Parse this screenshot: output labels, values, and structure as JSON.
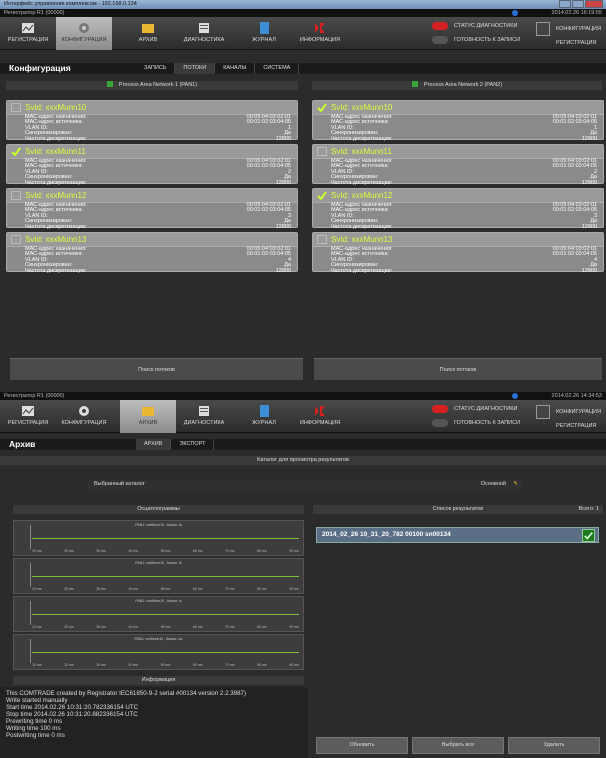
{
  "window_title": "Интерфейс управления комплексом - 192.168.0.134",
  "s1": {
    "device": "Регистратор R1 (00000)",
    "datetime": "2014.02.26 16:19:55"
  },
  "s2": {
    "device": "Регистратор R1 (00000)",
    "datetime": "2014.02.26 14:34:53"
  },
  "toolbar": {
    "items": [
      "РЕГИСТРАЦИЯ",
      "КОНФИГУРАЦИЯ",
      "АРХИВ",
      "ДИАГНОСТИКА",
      "ЖУРНАЛ",
      "ИНФОРМАЦИЯ"
    ],
    "status_diag": "СТАТУС ДИАГНОСТИКИ",
    "ready": "ГОТОВНОСТЬ К ЗАПИСИ",
    "r_conf": "КОНФИГУРАЦИЯ",
    "r_reg": "РЕГИСТРАЦИЯ",
    "status_color": "#d42020",
    "ready_color": "#555555"
  },
  "config": {
    "title": "Конфигурация",
    "tabs": [
      "ЗАПИСЬ",
      "ПОТОКИ",
      "КАНАЛЫ",
      "СИСТЕМА"
    ],
    "active_tab": "ПОТОКИ",
    "pan1": "Process Area Network 1 (PAN1)",
    "pan2": "Process Area Network 2 (PAN2)",
    "labels": {
      "dst": "МАС-адрес назначения:",
      "src": "МАС-адрес источника:",
      "vlan": "VLAN ID:",
      "sync": "Синхронизирован:",
      "rate": "Частота дискретизации:"
    },
    "left": [
      {
        "name": "SvId: xxxMunn10",
        "checked": false,
        "dst": "00:05:04:03:02:01",
        "src": "00:01:02:03:04:05",
        "vlan": "1",
        "sync": "Да",
        "rate": "12800"
      },
      {
        "name": "SvId: xxxMunn11",
        "checked": true,
        "dst": "00:05:04:03:02:01",
        "src": "00:01:02:03:04:05",
        "vlan": "2",
        "sync": "Да",
        "rate": "12800"
      },
      {
        "name": "SvId: xxxMunn12",
        "checked": false,
        "dst": "00:05:04:03:02:01",
        "src": "00:01:02:03:04:05",
        "vlan": "3",
        "sync": "Да",
        "rate": "12800"
      },
      {
        "name": "SvId: xxxMunn13",
        "checked": false,
        "dst": "00:05:04:03:02:01",
        "src": "00:01:02:03:04:05",
        "vlan": "4",
        "sync": "Да",
        "rate": "12800"
      }
    ],
    "right": [
      {
        "name": "SvId: xxxMunn10",
        "checked": true,
        "dst": "00:05:04:03:02:01",
        "src": "00:01:02:03:04:05",
        "vlan": "1",
        "sync": "Да",
        "rate": "12800"
      },
      {
        "name": "SvId: xxxMunn11",
        "checked": false,
        "dst": "00:05:04:03:02:01",
        "src": "00:01:02:03:04:05",
        "vlan": "2",
        "sync": "Да",
        "rate": "12800"
      },
      {
        "name": "SvId: xxxMunn12",
        "checked": true,
        "dst": "00:05:04:03:02:01",
        "src": "00:01:02:03:04:05",
        "vlan": "3",
        "sync": "Да",
        "rate": "12800"
      },
      {
        "name": "SvId: xxxMunn13",
        "checked": false,
        "dst": "00:05:04:03:02:01",
        "src": "00:01:02:03:04:05",
        "vlan": "4",
        "sync": "Да",
        "rate": "12800"
      }
    ],
    "search": "Поиск потоков"
  },
  "archive": {
    "title": "Архив",
    "tabs": [
      "АРХИВ",
      "ЭКСПОРТ"
    ],
    "catalog_header": "Каталог для просмотра результатов",
    "selected_catalog": "Выбранный каталог",
    "catalog_value": "Основной",
    "osc_header": "Осциллограммы",
    "results_header": "Список результатов",
    "total": "Всего: 1",
    "osc": [
      {
        "title": "PAN1: xxxMunn10 , Канал: Ia"
      },
      {
        "title": "PAN1: xxxMunn10 , Канал: Ib"
      },
      {
        "title": "PAN1: xxxMunn10 , Канал: Ic"
      },
      {
        "title": "PAN1: xxxMunn10 , Канал: Ua"
      }
    ],
    "osc_ticks": [
      "10 ms",
      "20 ms",
      "30 ms",
      "40 ms",
      "50 ms",
      "60 ms",
      "70 ms",
      "80 ms",
      "90 ms"
    ],
    "result": "2014_02_26 10_31_20_782 00100 sn00134",
    "info_header": "Информация",
    "info": {
      "l1": "This COMTRADE created by Registrator IEC61850-9-2 serial #00134 version 2.2.3987)",
      "l2": "Write started manually",
      "l3": "Start time 2014.02.26 10:31:20.782336154 UTC",
      "l4": "Stop time 2014.02.26 10:31:20.882336154 UTC",
      "l5": "Prewriting time 0 ms",
      "l6": "Writing time 100 ms",
      "l7": "Postwriting time 0 ms"
    },
    "buttons": {
      "refresh": "Обновить",
      "select_all": "Выбрать все",
      "delete": "Удалить"
    }
  }
}
